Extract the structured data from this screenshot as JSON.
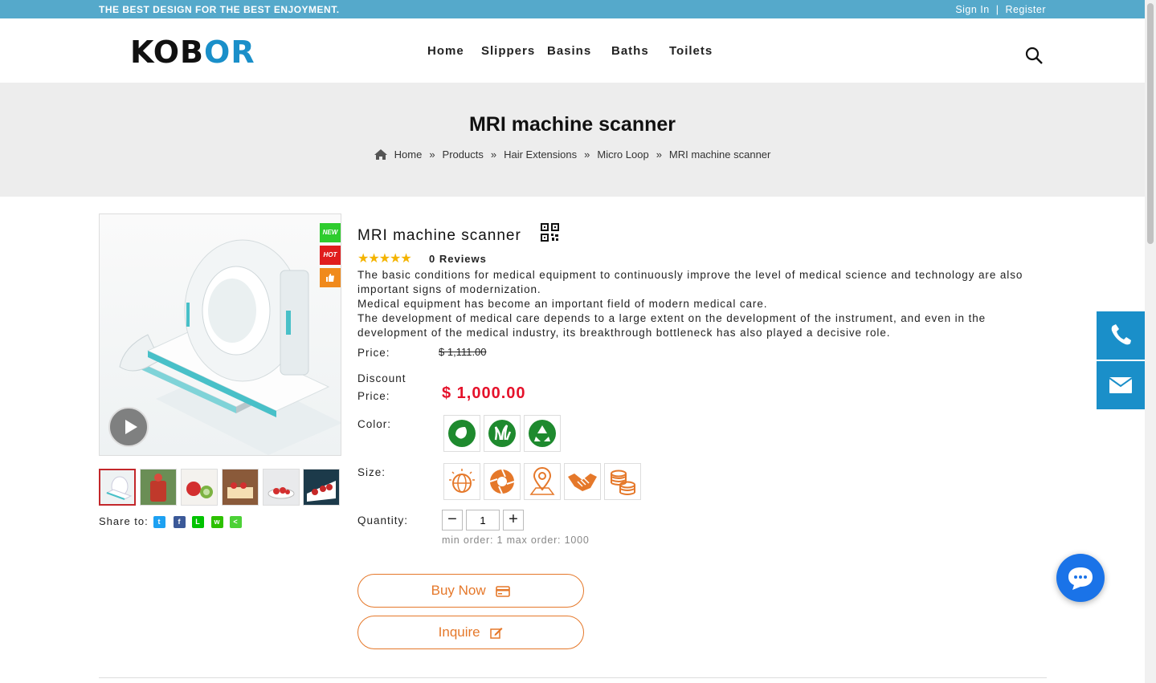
{
  "topbar": {
    "slogan": "THE BEST DESIGN FOR THE BEST ENJOYMENT.",
    "sign_in": "Sign In",
    "divider": "|",
    "register": "Register"
  },
  "header": {
    "logo_part1": "KOB",
    "logo_part2": "OR",
    "nav": [
      "Home",
      "Slippers",
      "Basins",
      "Baths",
      "Toilets"
    ],
    "search_icon": "search-icon"
  },
  "banner": {
    "title": "MRI machine scanner",
    "breadcrumb": [
      "Home",
      "Products",
      "Hair Extensions",
      "Micro Loop",
      "MRI machine scanner"
    ],
    "separator": "»"
  },
  "gallery": {
    "tags": [
      "NEW",
      "HOT"
    ],
    "thumb_count": 6
  },
  "share": {
    "label": "Share to:",
    "icons": [
      "twitter-icon",
      "facebook-icon",
      "line-icon",
      "wechat-icon",
      "share-icon"
    ]
  },
  "product": {
    "title": "MRI machine scanner",
    "rating": 5,
    "reviews": "0 Reviews",
    "description": [
      "The basic conditions for medical equipment to continuously improve the level of medical science and technology are also important signs of modernization.",
      "Medical equipment has become an important field of modern medical care.",
      "The development of medical care depends to a large extent on the development of the instrument, and even in the development of the medical industry, its breakthrough bottleneck has also played a decisive role."
    ],
    "price_label": "Price:",
    "old_price": "$ 1,111.00",
    "discount_label1": "Discount",
    "discount_label2": "Price:",
    "discount_price": "$ 1,000.00",
    "color_label": "Color:",
    "colors": [
      "leaf-eco-icon",
      "grass-icon",
      "recycle-icon"
    ],
    "size_label": "Size:",
    "sizes": [
      "globe-icon",
      "aperture-icon",
      "map-pin-icon",
      "handshake-icon",
      "coins-icon"
    ],
    "quantity_label": "Quantity:",
    "quantity": "1",
    "minus": "−",
    "plus": "+",
    "min_max": "min order: 1 max order: 1000",
    "buy_now": "Buy Now",
    "inquire": "Inquire"
  },
  "colors": {
    "accent": "#1a8fc9",
    "topbar": "#55a9cb",
    "price": "#e5122b",
    "cta": "#e5782a"
  }
}
